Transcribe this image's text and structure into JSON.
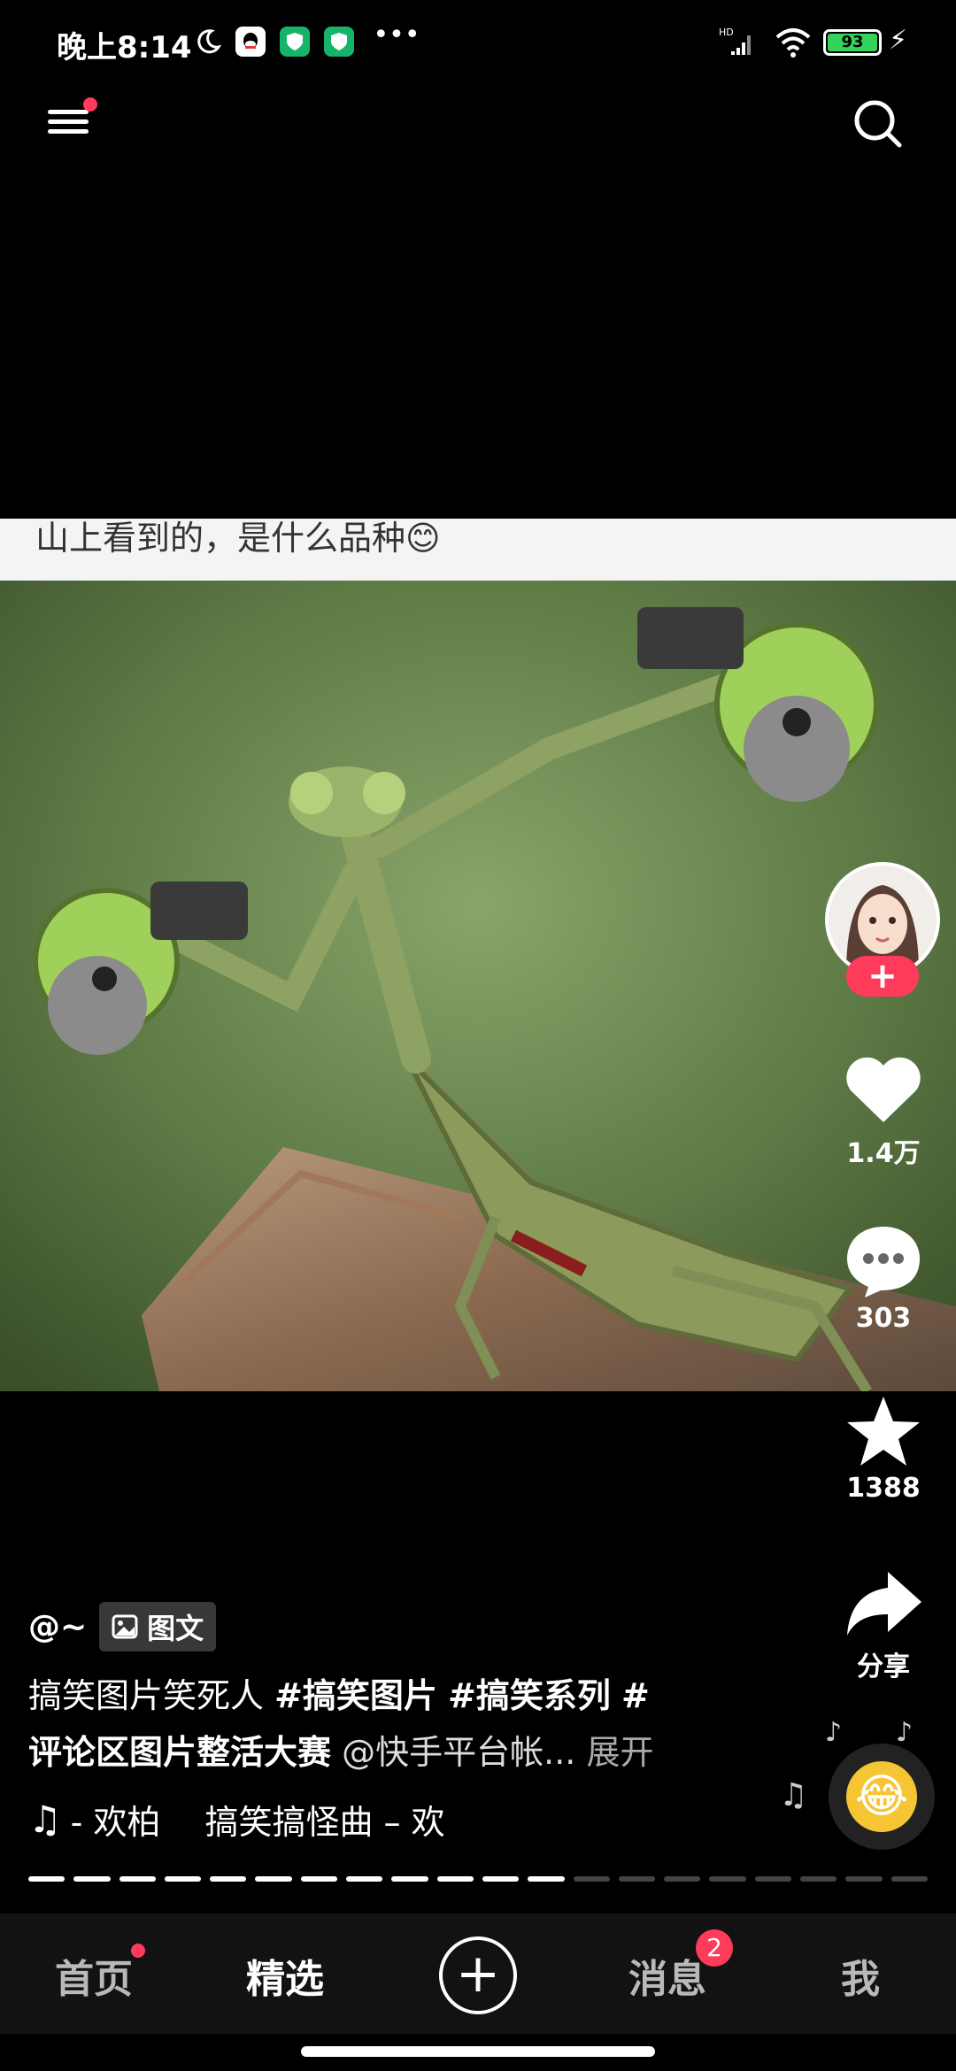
{
  "status_bar": {
    "time": "晚上8:14",
    "battery": "93",
    "network": "HD",
    "icons": [
      "moon-icon",
      "qq-icon",
      "shield-icon",
      "shield-icon",
      "more-dots-icon",
      "signal-icon",
      "wifi-icon",
      "battery-icon",
      "charging-icon"
    ]
  },
  "top_nav": {
    "icons": [
      "menu-icon",
      "search-icon"
    ]
  },
  "post": {
    "image_caption": "山上看到的，是什么品种😊",
    "author": "@~",
    "badge_label": "图文",
    "description": {
      "text": "搞笑图片笑死人 ",
      "tags": [
        "#搞笑图片",
        "#搞笑系列",
        "#"
      ],
      "tag2_line": "评论区图片整活大赛",
      "mention": "@快手平台帐...",
      "expand": "展开"
    },
    "music": {
      "part1": "- 欢柏",
      "part2": "搞笑搞怪曲 – 欢"
    },
    "progress": {
      "total_segments": 20,
      "filled_segments": 12
    }
  },
  "rail": {
    "follow_label": "+",
    "likes": "1.4万",
    "comments": "303",
    "favorites": "1388",
    "share_label": "分享"
  },
  "bottom_nav": {
    "home": "首页",
    "featured": "精选",
    "create": "+",
    "messages": "消息",
    "messages_badge": "2",
    "me": "我"
  },
  "colors": {
    "accent": "#ff3b5c",
    "battery": "#34d35b",
    "nav_bg": "#121212"
  }
}
